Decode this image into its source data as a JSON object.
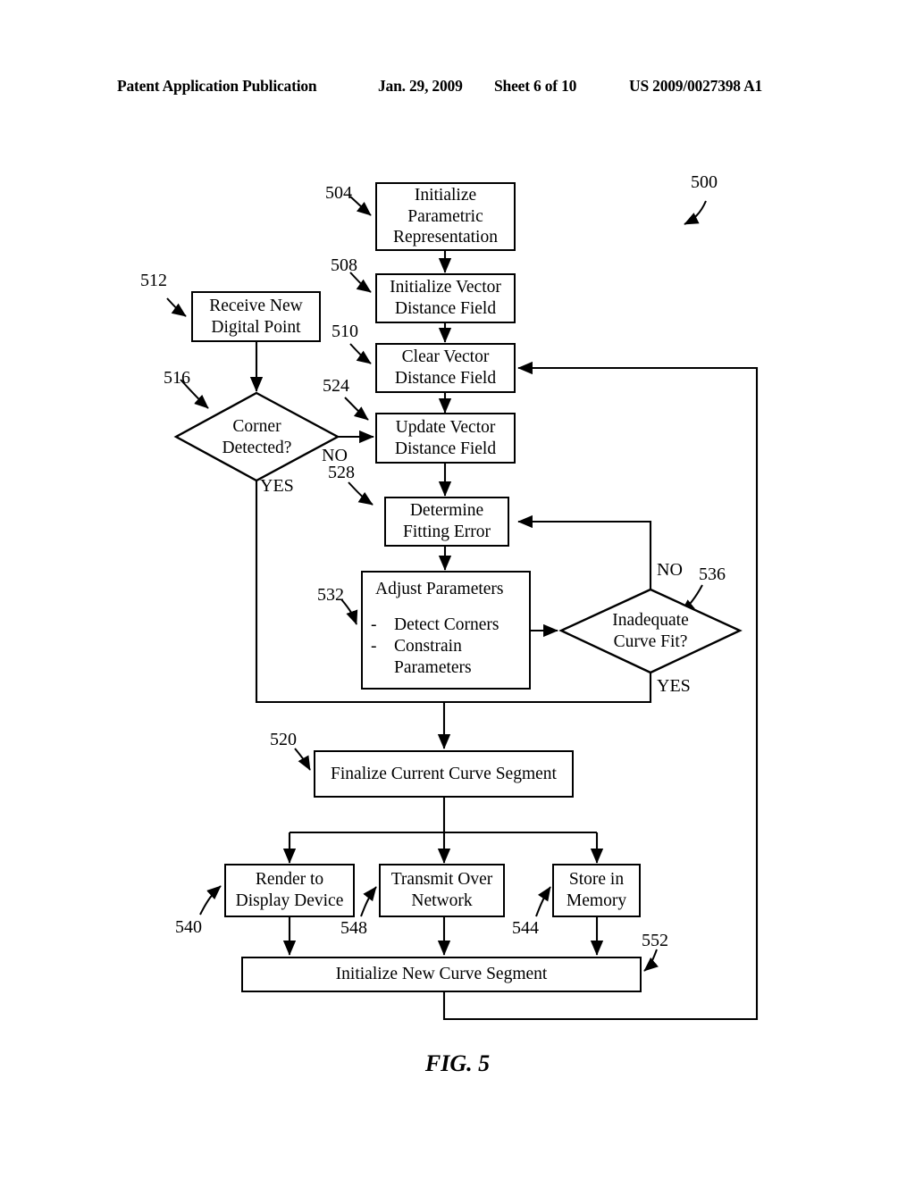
{
  "header": {
    "publication": "Patent Application Publication",
    "date": "Jan. 29, 2009",
    "sheet": "Sheet 6 of 10",
    "patent_number": "US 2009/0027398 A1"
  },
  "figure": {
    "caption": "FIG. 5",
    "diagram_label": "500"
  },
  "nodes": {
    "init_parametric": {
      "ref": "504",
      "label": "Initialize\nParametric\nRepresentation"
    },
    "init_vdf": {
      "ref": "508",
      "label": "Initialize Vector\nDistance Field"
    },
    "clear_vdf": {
      "ref": "510",
      "label": "Clear Vector\nDistance Field"
    },
    "receive_point": {
      "ref": "512",
      "label": "Receive New\nDigital Point"
    },
    "corner_detected": {
      "ref": "516",
      "label": "Corner\nDetected?"
    },
    "update_vdf": {
      "ref": "524",
      "label": "Update Vector\nDistance Field"
    },
    "determine_error": {
      "ref": "528",
      "label": "Determine\nFitting Error"
    },
    "adjust_parameters": {
      "ref": "532",
      "title": "Adjust Parameters",
      "items": [
        {
          "bullet": "-",
          "text": "Detect Corners"
        },
        {
          "bullet": "-",
          "text": "Constrain\nParameters"
        }
      ]
    },
    "inadequate_fit": {
      "ref": "536",
      "label": "Inadequate\nCurve Fit?"
    },
    "finalize_segment": {
      "ref": "520",
      "label": "Finalize Current Curve Segment"
    },
    "render_display": {
      "ref": "540",
      "label": "Render to\nDisplay Device"
    },
    "transmit_network": {
      "ref": "548",
      "label": "Transmit Over\nNetwork"
    },
    "store_memory": {
      "ref": "544",
      "label": "Store in\nMemory"
    },
    "init_new_segment": {
      "ref": "552",
      "label": "Initialize New Curve Segment"
    }
  },
  "edge_labels": {
    "corner_no": "NO",
    "corner_yes": "YES",
    "fit_no": "NO",
    "fit_yes": "YES"
  },
  "colors": {
    "line": "#000000",
    "background": "#ffffff"
  }
}
